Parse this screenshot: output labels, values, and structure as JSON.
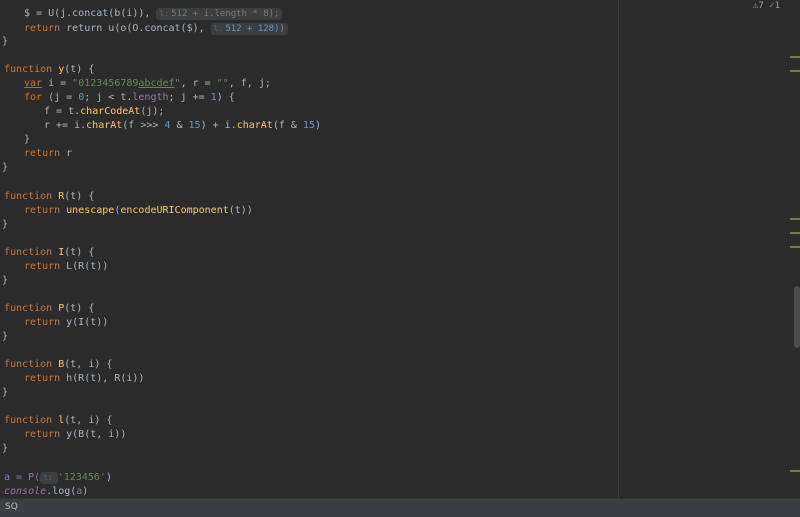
{
  "editor": {
    "line_top": "$ = U(j.concat(b(i)),",
    "line_top_hint": "512 + i.length * 8);",
    "line_ret_u_a": "return u(o(O.concat($),",
    "line_ret_u_hint": "512 + 128))",
    "fn_y": "function",
    "fn_y_name": "y",
    "fn_y_args": "(t) {",
    "var_kw": "var",
    "var_decl": " i = ",
    "var_str": "\"0123456789",
    "var_str_u": "abcdef",
    "var_str_end": "\"",
    "var_rest": ", r = ",
    "var_empty": "\"\"",
    "var_tail": ", f, j;",
    "for_kw": "for",
    "for_a": " (j = ",
    "for_0": "0",
    "for_b": "; j < t.",
    "for_len": "length",
    "for_c": "; j += ",
    "for_1": "1",
    "for_d": ") {",
    "f_assign": "f = t.",
    "f_method": "charCodeAt",
    "f_end": "(j);",
    "r_a": "r += i.",
    "r_m1": "charAt",
    "r_b": "(f >>> ",
    "r_4": "4",
    "r_c": " & ",
    "r_15a": "15",
    "r_d": ") + i.",
    "r_m2": "charAt",
    "r_e": "(f & ",
    "r_15b": "15",
    "r_f": ")",
    "close1": "}",
    "ret_kw": "return",
    "ret_r": " r",
    "close0": "}",
    "fn_R": "R",
    "fn_R_args": "(t) {",
    "ret_R_fn": "unescape",
    "ret_R_mid": "(",
    "ret_R_fn2": "encodeURIComponent",
    "ret_R_end": "(t))",
    "fn_I": "I",
    "fn_I_args": "(t) {",
    "ret_I": " L(R(t))",
    "fn_P": "P",
    "fn_P_args": "(t) {",
    "ret_P": " y(I(t))",
    "fn_B": "B",
    "fn_B_args": "(t, i) {",
    "ret_B": " h(R(t), R(i))",
    "fn_l": "l",
    "fn_l_args": "(t, i) {",
    "ret_l": " y(B(t, i))",
    "call_a": "a = P(",
    "call_hint": "t",
    "call_str": "'123456'",
    "call_end": ")",
    "console": "console",
    "log": ".log(",
    "log_arg": "a",
    "log_end": ")"
  },
  "inspections": {
    "warn_icon": "warning-triangle",
    "warn_count": "7",
    "ok_icon": "check",
    "ok_count": "1"
  },
  "statusbar": {
    "label": "SQ"
  }
}
